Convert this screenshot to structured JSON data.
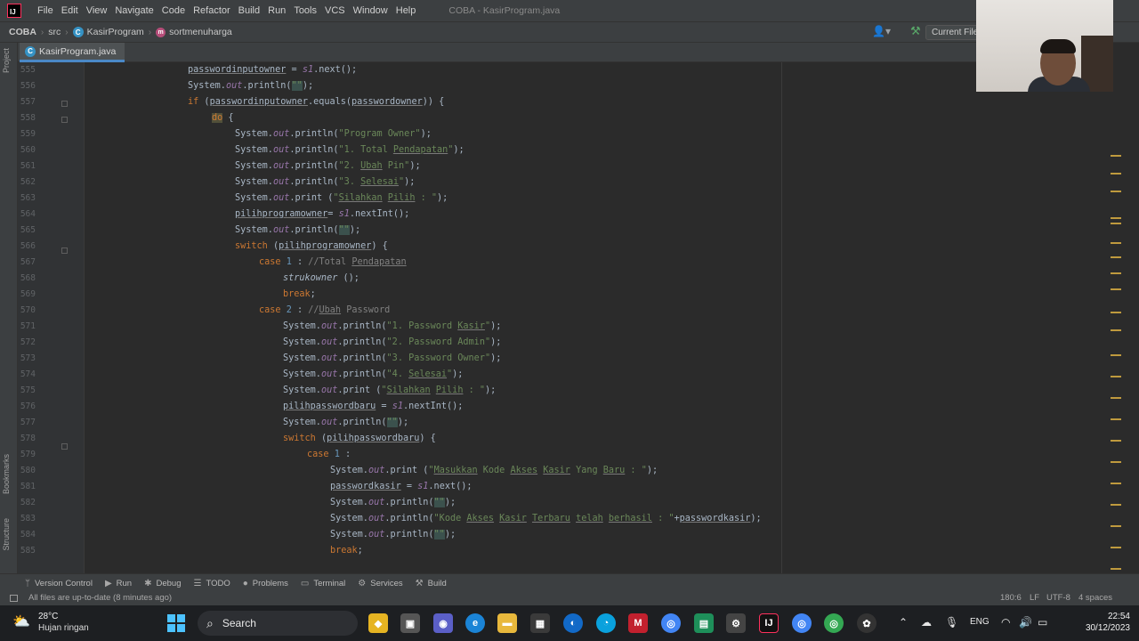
{
  "app": {
    "logo_text": "IJ",
    "window_title": "COBA - KasirProgram.java"
  },
  "menu": [
    "File",
    "Edit",
    "View",
    "Navigate",
    "Code",
    "Refactor",
    "Build",
    "Run",
    "Tools",
    "VCS",
    "Window",
    "Help"
  ],
  "breadcrumb": {
    "project": "COBA",
    "folder": "src",
    "class": "KasirProgram",
    "method": "sortmenuharga"
  },
  "toolbar": {
    "run_config": "Current File"
  },
  "side_tabs": {
    "project": "Project",
    "bookmarks": "Bookmarks",
    "structure": "Structure"
  },
  "editor_tab": {
    "file": "KasirProgram.java"
  },
  "code_lines": [
    {
      "n": "555",
      "text": "passwordinputowner = s1.next();"
    },
    {
      "n": "556",
      "text": "System.out.println(\"\");"
    },
    {
      "n": "557",
      "text": "if (passwordinputowner.equals(passwordowner)) {"
    },
    {
      "n": "558",
      "text": "do {"
    },
    {
      "n": "559",
      "text": "System.out.println(\"Program Owner\");"
    },
    {
      "n": "560",
      "text": "System.out.println(\"1. Total Pendapatan\");"
    },
    {
      "n": "561",
      "text": "System.out.println(\"2. Ubah Pin\");"
    },
    {
      "n": "562",
      "text": "System.out.println(\"3. Selesai\");"
    },
    {
      "n": "563",
      "text": "System.out.print (\"Silahkan Pilih : \");"
    },
    {
      "n": "564",
      "text": "pilihprogramowner= s1.nextInt();"
    },
    {
      "n": "565",
      "text": "System.out.println(\"\");"
    },
    {
      "n": "566",
      "text": "switch (pilihprogramowner) {"
    },
    {
      "n": "567",
      "text": "case 1 : //Total Pendapatan"
    },
    {
      "n": "568",
      "text": "strukowner ();"
    },
    {
      "n": "569",
      "text": "break;"
    },
    {
      "n": "570",
      "text": "case 2 : //Ubah Password"
    },
    {
      "n": "571",
      "text": "System.out.println(\"1. Password Kasir\");"
    },
    {
      "n": "572",
      "text": "System.out.println(\"2. Password Admin\");"
    },
    {
      "n": "573",
      "text": "System.out.println(\"3. Password Owner\");"
    },
    {
      "n": "574",
      "text": "System.out.println(\"4. Selesai\");"
    },
    {
      "n": "575",
      "text": "System.out.print (\"Silahkan Pilih : \");"
    },
    {
      "n": "576",
      "text": "pilihpasswordbaru = s1.nextInt();"
    },
    {
      "n": "577",
      "text": "System.out.println(\"\");"
    },
    {
      "n": "578",
      "text": "switch (pilihpasswordbaru) {"
    },
    {
      "n": "579",
      "text": "case 1 :"
    },
    {
      "n": "580",
      "text": "System.out.print (\"Masukkan Kode Akses Kasir Yang Baru : \");"
    },
    {
      "n": "581",
      "text": "passwordkasir = s1.next();"
    },
    {
      "n": "582",
      "text": "System.out.println(\"\");"
    },
    {
      "n": "583",
      "text": "System.out.println(\"Kode Akses Kasir Terbaru telah berhasil : \"+passwordkasir);"
    },
    {
      "n": "584",
      "text": "System.out.println(\"\");"
    },
    {
      "n": "585",
      "text": "break;"
    }
  ],
  "tool_windows": [
    "Version Control",
    "Run",
    "Debug",
    "TODO",
    "Problems",
    "Terminal",
    "Services",
    "Build"
  ],
  "status": {
    "message": "All files are up-to-date (8 minutes ago)",
    "position": "180:6",
    "line_sep": "LF",
    "encoding": "UTF-8",
    "indent": "4 spaces"
  },
  "taskbar": {
    "weather_temp": "28°C",
    "weather_desc": "Hujan ringan",
    "search_label": "Search",
    "lang": "ENG",
    "time": "22:54",
    "date": "30/12/2023"
  },
  "colors": {
    "keyword": "#cc7832",
    "string": "#6a8759",
    "field": "#9876aa",
    "comment": "#808080",
    "accent": "#4a88c7"
  }
}
